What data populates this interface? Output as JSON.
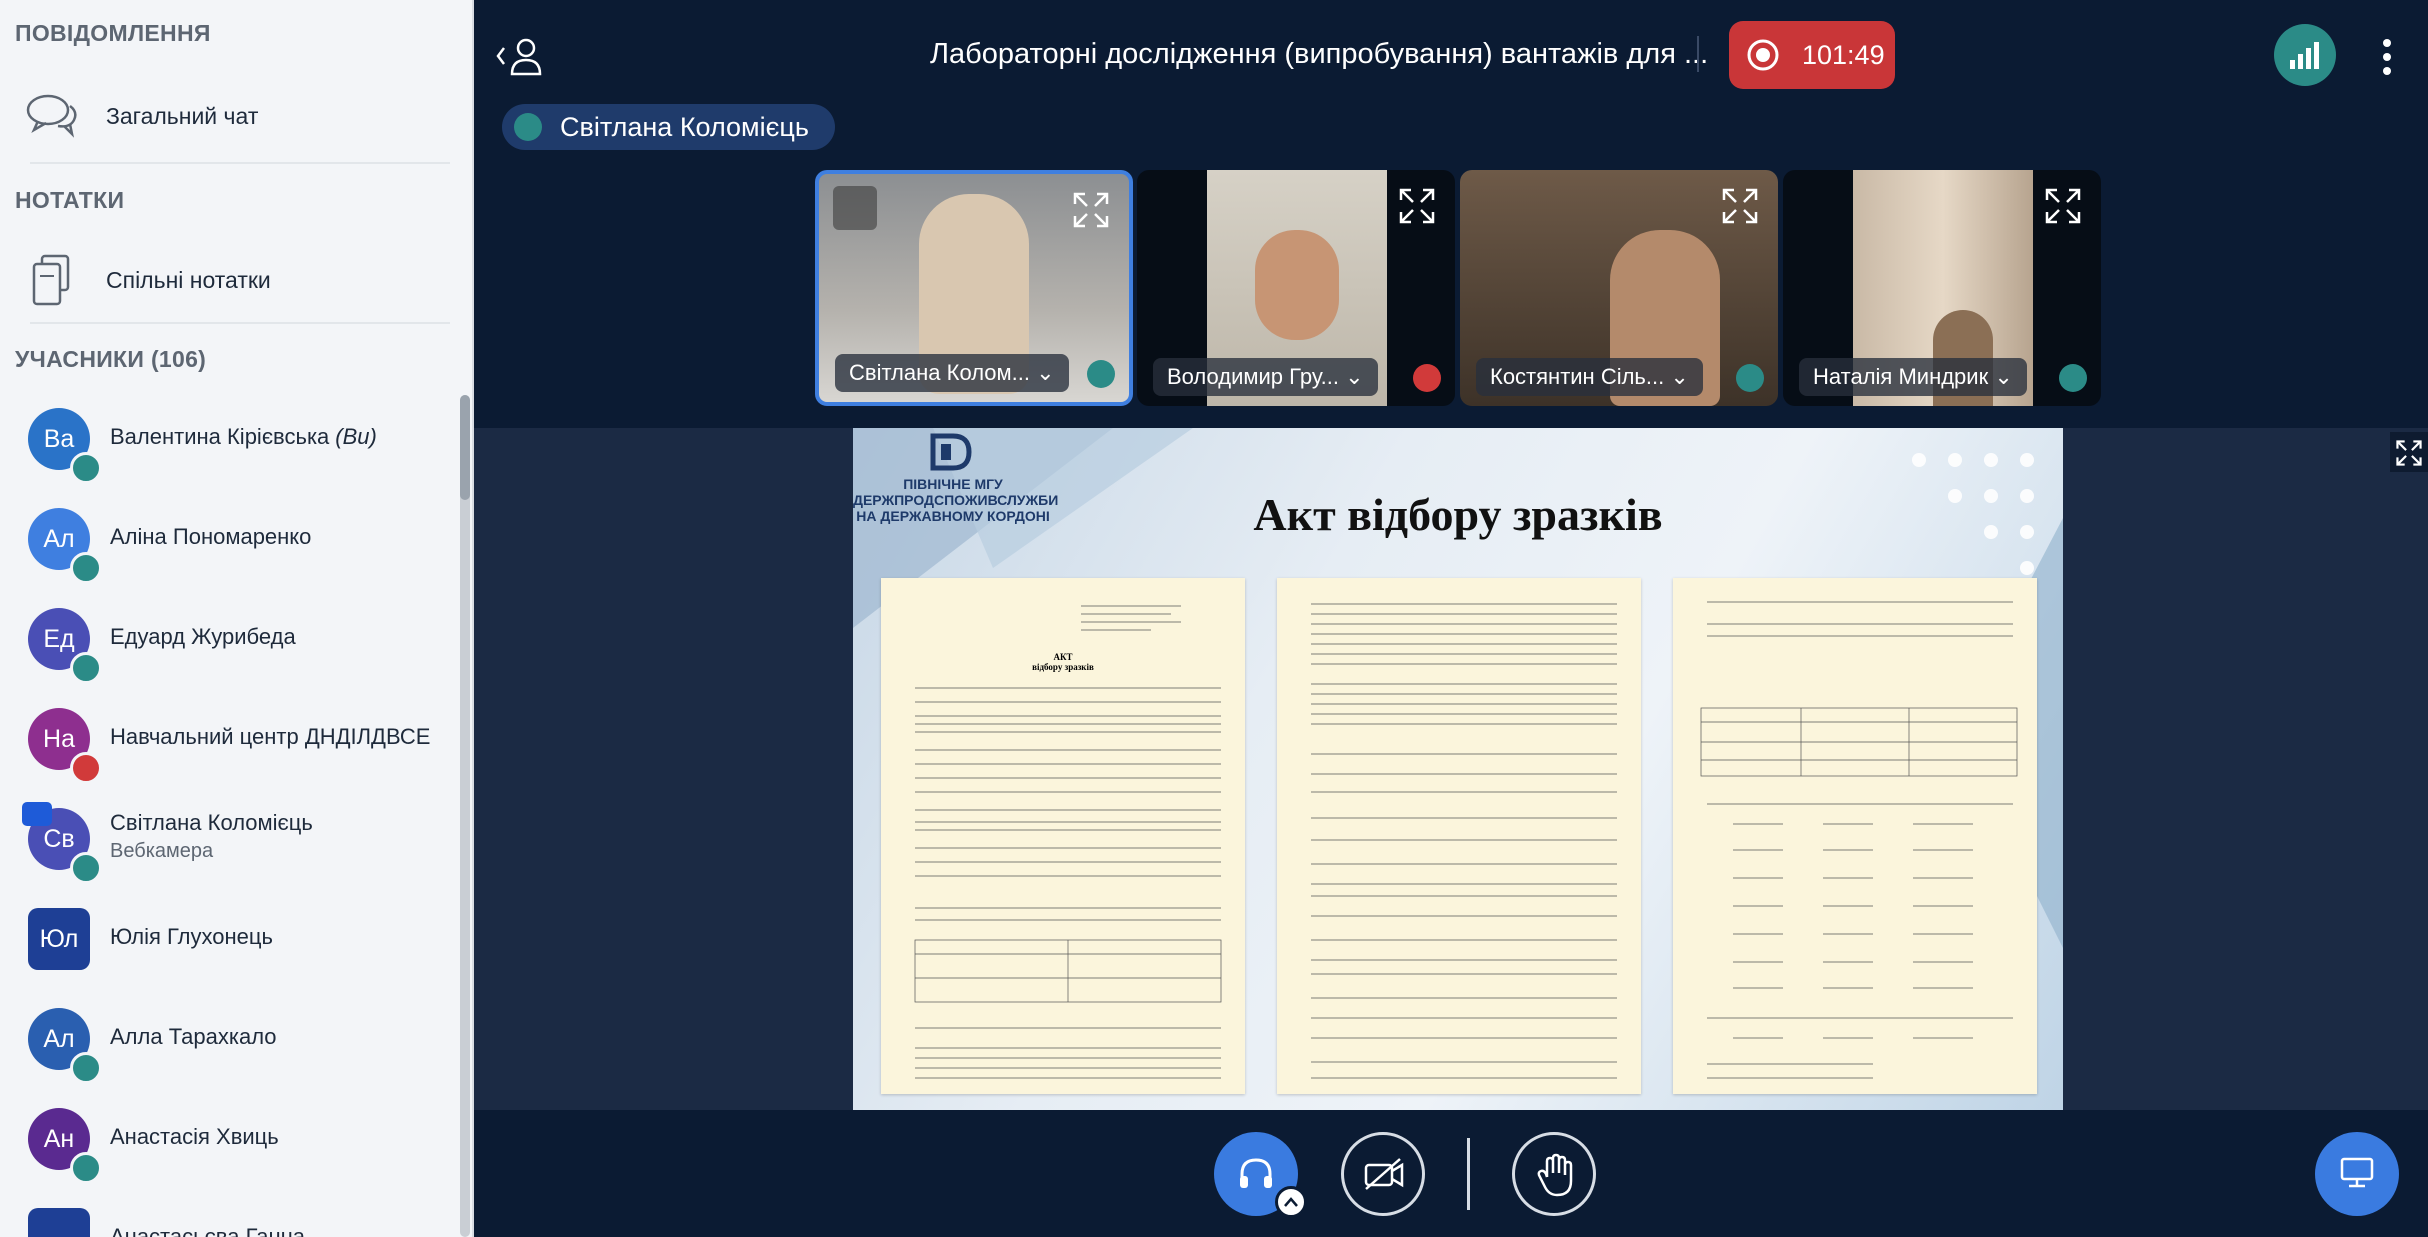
{
  "sidebar": {
    "messages_title": "ПОВІДОМЛЕННЯ",
    "public_chat": "Загальний чат",
    "notes_title": "НОТАТКИ",
    "shared_notes": "Спільні нотатки",
    "users_title": "УЧАСНИКИ",
    "users_count": "(106)",
    "users": [
      {
        "initials": "Ва",
        "name": "Валентина Кірієвська",
        "you": "(Ви)",
        "color": "#2a73c8",
        "status": "listen"
      },
      {
        "initials": "Ал",
        "name": "Аліна Пономаренко",
        "color": "#3f7fe0",
        "status": "listen"
      },
      {
        "initials": "Ед",
        "name": "Едуард Журибеда",
        "color": "#4a4fb5",
        "status": "listen"
      },
      {
        "initials": "На",
        "name": "Навчальний центр ДНДІЛДВСЕ",
        "color": "#8e2f8f",
        "status": "muted"
      },
      {
        "initials": "Св",
        "name": "Світлана Коломієць",
        "sub": "Вебкамера",
        "color": "#4a4fb5",
        "status": "mic"
      },
      {
        "initials": "Юл",
        "name": "Юлія Глухонець",
        "color": "#1e3f95",
        "status": "none"
      },
      {
        "initials": "Ал",
        "name": "Алла Тарахкало",
        "color": "#2a5fb0",
        "status": "listen"
      },
      {
        "initials": "Ан",
        "name": "Анастасія Хвиць",
        "color": "#5a2a90",
        "status": "listen"
      },
      {
        "initials": "",
        "name": "Анастасьєва Ганна",
        "color": "#1e3f95",
        "status": "none"
      }
    ]
  },
  "topbar": {
    "title": "Лабораторні дослідження (випробування) вантажів для ...",
    "rec_time": "101:49"
  },
  "speaker": {
    "name": "Світлана Коломієць"
  },
  "tiles": [
    {
      "name": "Світлана Колом... ⌄",
      "audio": "mic",
      "active": true
    },
    {
      "name": "Володимир Гру... ⌄",
      "audio": "muted"
    },
    {
      "name": "Костянтин Сіль... ⌄",
      "audio": "listen"
    },
    {
      "name": "Наталія Миндрик ⌄",
      "audio": "listen"
    }
  ],
  "slide": {
    "title": "Акт відбору зразків",
    "org_line1": "ПІВНІЧНЕ МГУ",
    "org_line2": "ДЕРЖПРОДСПОЖИВСЛУЖБИ",
    "org_line3": "НА ДЕРЖАВНОМУ КОРДОНІ",
    "doc1_heading": "АКТ",
    "doc1_sub": "відбору зразків"
  },
  "colors": {
    "accent": "#3a7be0",
    "record": "#c93638",
    "teal": "#2b8b87",
    "muted": "#d13a3a"
  }
}
